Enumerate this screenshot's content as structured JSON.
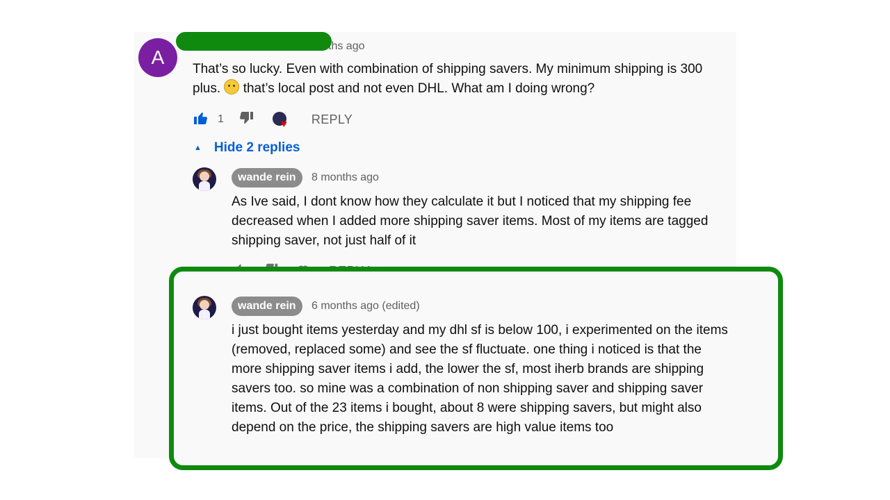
{
  "top_comment": {
    "avatar_letter": "A",
    "time": "ths ago",
    "text_before_emoji": "That’s so lucky. Even with combination of shipping savers. My minimum shipping is 300 plus.",
    "text_after_emoji": "that’s local post and not even DHL. What am I doing wrong?",
    "like_count": "1",
    "reply_label": "REPLY",
    "hide_replies_label": "Hide 2 replies"
  },
  "replies": [
    {
      "author": "wande rein",
      "time": "8 months ago",
      "text": "As Ive said, I dont know how they calculate it but I noticed that my shipping fee decreased when I added more shipping saver items. Most of my items are tagged shipping saver, not just half of it",
      "reply_label": "REPLY"
    },
    {
      "author": "wande rein",
      "time": "6 months ago (edited)",
      "text": "i just bought items yesterday and my dhl sf is below 100, i experimented on the items (removed, replaced some) and see the sf fluctuate. one thing i noticed is that the more shipping saver items i add, the lower the sf, most iherb brands are shipping savers too. so mine was a combination of non shipping saver and shipping saver items.  Out of the 23 items i bought, about 8 were shipping savers, but might also depend on the price, the shipping savers are high value items too"
    }
  ],
  "colors": {
    "highlight": "#0f8a0f",
    "link": "#065fd4",
    "avatar_purple": "#7b1fa2",
    "like_active": "#065fd4"
  },
  "icons": [
    "thumbs-up-icon",
    "thumbs-down-icon",
    "creator-heart-icon",
    "caret-up-icon"
  ]
}
